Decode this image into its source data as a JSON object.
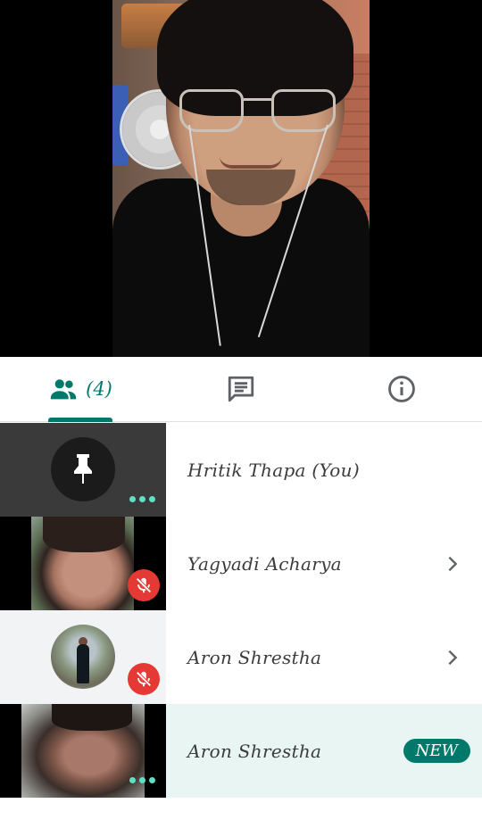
{
  "tabs": {
    "people_count": "(4)",
    "active": "people"
  },
  "participants": [
    {
      "name": "Hritik Thapa (You)",
      "thumb": "pin-icon",
      "muted": false,
      "more": true,
      "trailing": ""
    },
    {
      "name": "Yagyadi Acharya",
      "thumb": "video",
      "muted": true,
      "more": false,
      "trailing": "chevron"
    },
    {
      "name": "Aron Shrestha",
      "thumb": "photo",
      "muted": true,
      "more": false,
      "trailing": "chevron"
    },
    {
      "name": "Aron Shrestha",
      "thumb": "video",
      "muted": false,
      "more": true,
      "trailing": "badge",
      "badge_label": "NEW"
    }
  ],
  "colors": {
    "accent": "#00796b",
    "mute_red": "#e53935",
    "more_dots": "#5ee0c6",
    "highlight_row": "#e8f5f3"
  }
}
